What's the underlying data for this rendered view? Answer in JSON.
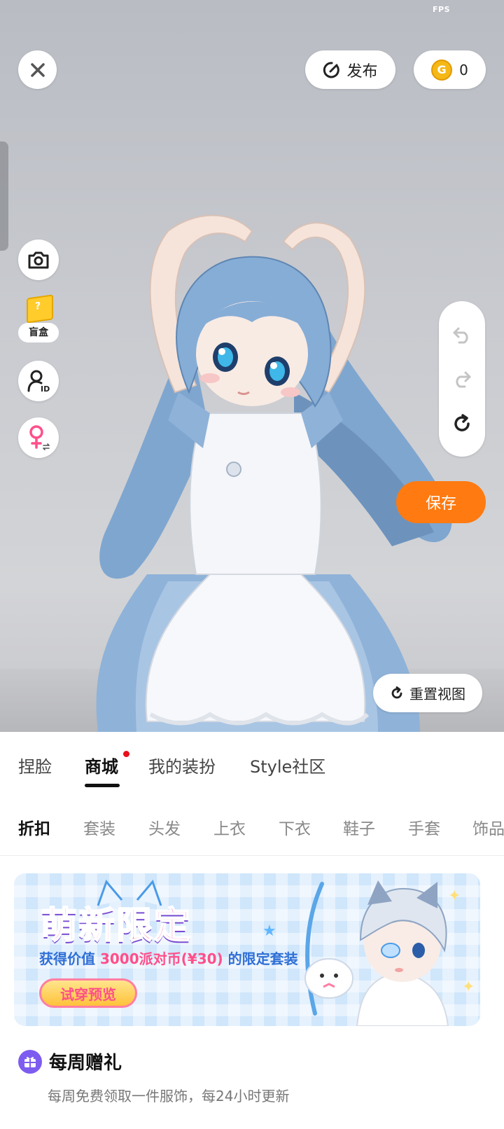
{
  "status": {
    "fps_label": "FPS",
    "fps_value": ""
  },
  "top_bar": {
    "publish_label": "发布",
    "coin_count": "0",
    "coin_glyph": "G"
  },
  "left_tools": {
    "blind_box_label": "盲盒",
    "blind_box_glyph": "?"
  },
  "actions": {
    "save_label": "保存",
    "reset_view_label": "重置视图"
  },
  "main_tabs": [
    {
      "label": "捏脸"
    },
    {
      "label": "商城"
    },
    {
      "label": "我的装扮"
    },
    {
      "label": "Style社区"
    }
  ],
  "categories": [
    {
      "label": "折扣"
    },
    {
      "label": "套装"
    },
    {
      "label": "头发"
    },
    {
      "label": "上衣"
    },
    {
      "label": "下衣"
    },
    {
      "label": "鞋子"
    },
    {
      "label": "手套"
    },
    {
      "label": "饰品"
    }
  ],
  "banner": {
    "title": "萌新限定",
    "subtitle_pre": "获得价值 ",
    "subtitle_highlight": "3000派对币(¥30)",
    "subtitle_post": " 的限定套装",
    "cta_label": "试穿预览"
  },
  "weekly_gift": {
    "title": "每周赠礼",
    "description": "每周免费领取一件服饰，每24小时更新"
  },
  "colors": {
    "accent_orange": "#ff7a10",
    "notification_red": "#e8101a",
    "coin_gold": "#f5b816",
    "gender_pink": "#ff4f8a",
    "gift_purple": "#7d5cf0"
  }
}
